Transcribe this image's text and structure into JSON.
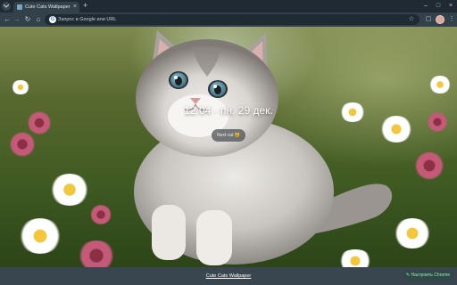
{
  "browser": {
    "tab": {
      "title": "Cute Cats Wallpaper",
      "close_icon": "×"
    },
    "new_tab_icon": "+",
    "window_controls": {
      "minimize": "–",
      "maximize": "□",
      "close": "×"
    },
    "toolbar": {
      "back": "←",
      "forward": "→",
      "reload": "↻",
      "home": "⌂",
      "omnibox_placeholder": "Запрос в Google или URL",
      "google_icon_letter": "G",
      "bookmark_icon": "☆",
      "extensions_icon": "▢",
      "menu_icon": "⋮"
    }
  },
  "wallpaper": {
    "clock": "12:04 · пн, 29 дек.",
    "next_button": {
      "label": "Next cat",
      "emoji": "🐱"
    }
  },
  "footer": {
    "credit": "Cute Cats Wallpaper",
    "customize_label": "Настроить Chrome",
    "customize_icon": "✎"
  },
  "colors": {
    "tabstrip": "#1f2a33",
    "toolbar": "#33414b",
    "footer": "#3a464f",
    "accent_customize": "#a8e0c8"
  }
}
